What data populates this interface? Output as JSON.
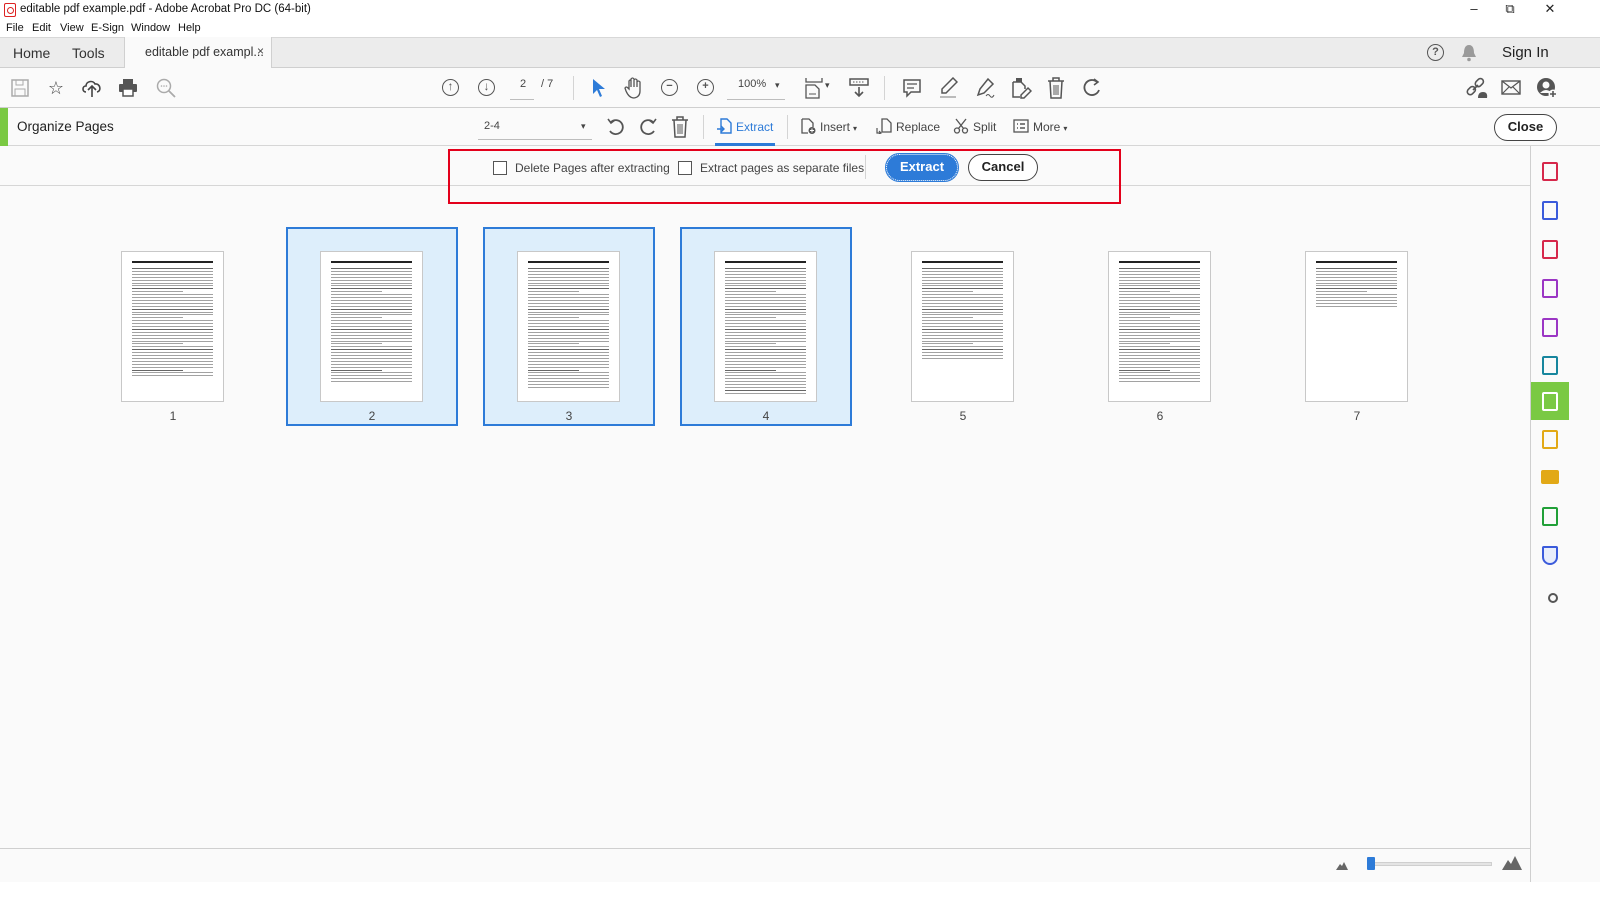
{
  "window": {
    "title": "editable pdf example.pdf - Adobe Acrobat Pro DC (64-bit)",
    "controls": {
      "minimize": "–",
      "restore": "⧉",
      "close": "✕"
    }
  },
  "menu": [
    "File",
    "Edit",
    "View",
    "E-Sign",
    "Window",
    "Help"
  ],
  "tabs": {
    "home": "Home",
    "tools": "Tools",
    "document": "editable pdf exampl...",
    "document_close": "×",
    "help_icon": "?",
    "sign_in": "Sign In"
  },
  "toolbar": {
    "current_page": "2",
    "page_total": "/ 7",
    "zoom_level": "100%",
    "dropdown_arrow": "▾"
  },
  "organize": {
    "title": "Organize Pages",
    "page_range": "2-4",
    "tools": {
      "extract": "Extract",
      "insert": "Insert",
      "replace": "Replace",
      "split": "Split",
      "more": "More"
    },
    "close": "Close"
  },
  "extract_options": {
    "delete_pages_label": "Delete Pages after extracting",
    "delete_pages_checked": false,
    "separate_files_label": "Extract pages as separate files",
    "separate_files_checked": false,
    "extract_button": "Extract",
    "cancel_button": "Cancel"
  },
  "pages": [
    {
      "number": "1",
      "selected": false
    },
    {
      "number": "2",
      "selected": true
    },
    {
      "number": "3",
      "selected": true
    },
    {
      "number": "4",
      "selected": true
    },
    {
      "number": "5",
      "selected": false
    },
    {
      "number": "6",
      "selected": false
    },
    {
      "number": "7",
      "selected": false
    }
  ],
  "right_panel": [
    {
      "name": "create-pdf-icon",
      "color": "#d6284b"
    },
    {
      "name": "export-pdf-icon",
      "color": "#3b5bdb"
    },
    {
      "name": "edit-pdf-icon",
      "color": "#d6284b"
    },
    {
      "name": "create-form-icon",
      "color": "#9b36c4"
    },
    {
      "name": "fill-sign-icon",
      "color": "#9b36c4"
    },
    {
      "name": "send-for-signature-icon",
      "color": "#17869e"
    },
    {
      "name": "organize-pages-icon",
      "color": "#ffffff",
      "active": true
    },
    {
      "name": "send-for-comments-icon",
      "color": "#e2a916"
    },
    {
      "name": "comment-icon",
      "color": "#e2a916"
    },
    {
      "name": "scan-ocr-icon",
      "color": "#21a038"
    },
    {
      "name": "protect-icon",
      "color": "#3b5bdb"
    },
    {
      "name": "more-tools-icon",
      "color": "#555555"
    }
  ],
  "colors": {
    "accent_blue": "#2d7bd8",
    "accent_green": "#7ac943",
    "highlight_red": "#e3001b",
    "selection_fill": "#ddeefb"
  },
  "zoom_slider": {
    "value_fraction": 0.0
  }
}
